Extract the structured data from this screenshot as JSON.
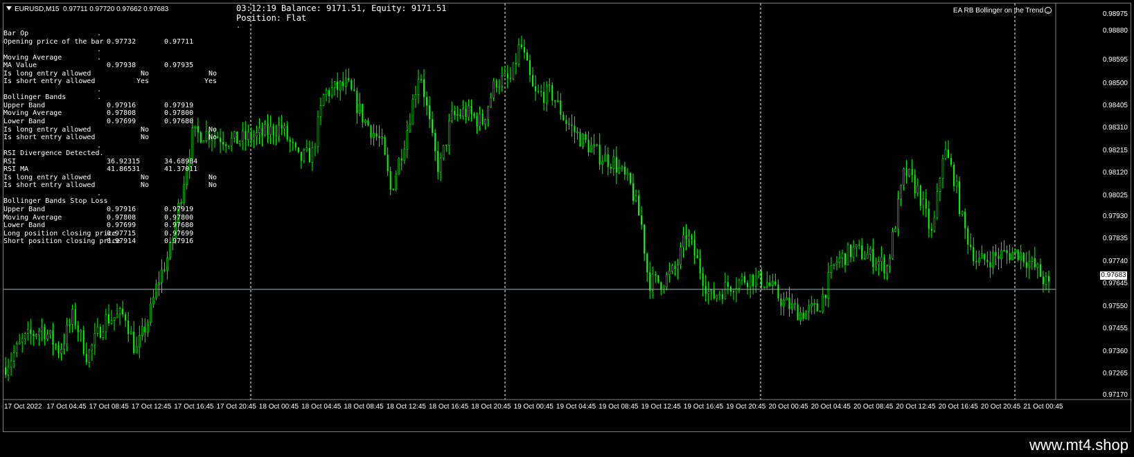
{
  "header": {
    "symbol": "EURUSD,M15",
    "ohlc": "0.97711 0.97720 0.97662 0.97683"
  },
  "status": {
    "line1": "03:12:19 Balance: 9171.51, Equity: 9171.51",
    "line2": "Position: Flat",
    "dot": "."
  },
  "ea_name": "EA RB Bollinger on the Trend",
  "info_panel": [
    {
      "label": "Bar Op",
      "v1": "",
      "v2": "",
      "v3": "",
      "dot": "."
    },
    {
      "label": "Opening price of the bar",
      "v1": "0.97732",
      "v2": "0.97711",
      "v3": ""
    },
    {
      "label": "",
      "v1": "",
      "v2": "",
      "v3": "",
      "dot": "."
    },
    {
      "label": "Moving Average",
      "v1": "",
      "v2": "",
      "v3": "",
      "dot": "."
    },
    {
      "label": "MA Value",
      "v1": "0.97938",
      "v2": "0.97935",
      "v3": ""
    },
    {
      "label": "Is long entry allowed",
      "v1": "No",
      "v2": "",
      "v3": "No"
    },
    {
      "label": "Is short entry allowed",
      "v1": "Yes",
      "v2": "",
      "v3": "Yes"
    },
    {
      "label": "",
      "v1": "",
      "v2": "",
      "v3": "",
      "dot": "."
    },
    {
      "label": "Bollinger Bands",
      "v1": "",
      "v2": "",
      "v3": "",
      "dot": "."
    },
    {
      "label": "Upper Band",
      "v1": "0.97916",
      "v2": "0.97919",
      "v3": ""
    },
    {
      "label": "Moving Average",
      "v1": "0.97808",
      "v2": "0.97800",
      "v3": ""
    },
    {
      "label": "Lower Band",
      "v1": "0.97699",
      "v2": "0.97680",
      "v3": ""
    },
    {
      "label": "Is long entry allowed",
      "v1": "No",
      "v2": "",
      "v3": "No"
    },
    {
      "label": "Is short entry allowed",
      "v1": "No",
      "v2": "",
      "v3": "No"
    },
    {
      "label": "",
      "v1": "",
      "v2": "",
      "v3": "",
      "dot": "."
    },
    {
      "label": "RSI Divergence Detected.",
      "v1": "",
      "v2": "",
      "v3": ""
    },
    {
      "label": "RSI",
      "v1": "36.92315",
      "v2": "34.68984",
      "v3": ""
    },
    {
      "label": "RSI MA",
      "v1": "41.86531",
      "v2": "41.37011",
      "v3": ""
    },
    {
      "label": "Is long entry allowed",
      "v1": "No",
      "v2": "",
      "v3": "No"
    },
    {
      "label": "Is short entry allowed",
      "v1": "No",
      "v2": "",
      "v3": "No"
    },
    {
      "label": "",
      "v1": "",
      "v2": "",
      "v3": "",
      "dot": "."
    },
    {
      "label": "Bollinger Bands Stop Loss",
      "v1": "",
      "v2": "",
      "v3": ""
    },
    {
      "label": "Upper Band",
      "v1": "0.97916",
      "v2": "0.97919",
      "v3": ""
    },
    {
      "label": "Moving Average",
      "v1": "0.97808",
      "v2": "0.97800",
      "v3": ""
    },
    {
      "label": "Lower Band",
      "v1": "0.97699",
      "v2": "0.97680",
      "v3": ""
    },
    {
      "label": "Long position closing price",
      "v1": "0.97715",
      "v2": "0.97699",
      "v3": ""
    },
    {
      "label": "Short position closing price",
      "v1": "0.97914",
      "v2": "0.97916",
      "v3": ""
    }
  ],
  "price_axis": {
    "labels": [
      "0.98975",
      "0.98880",
      "0.98595",
      "0.98500",
      "0.98405",
      "0.98310",
      "0.98215",
      "0.98120",
      "0.98025",
      "0.97930",
      "0.97835",
      "0.97740",
      "0.97645",
      "0.97550",
      "0.97455",
      "0.97360",
      "0.97265",
      "0.97170"
    ],
    "current_price": "0.97683"
  },
  "time_axis": {
    "labels": [
      "17 Oct 2022",
      "17 Oct 04:45",
      "17 Oct 08:45",
      "17 Oct 12:45",
      "17 Oct 16:45",
      "17 Oct 20:45",
      "18 Oct 00:45",
      "18 Oct 04:45",
      "18 Oct 08:45",
      "18 Oct 12:45",
      "18 Oct 16:45",
      "18 Oct 20:45",
      "19 Oct 00:45",
      "19 Oct 04:45",
      "19 Oct 08:45",
      "19 Oct 12:45",
      "19 Oct 16:45",
      "19 Oct 20:45",
      "20 Oct 00:45",
      "20 Oct 04:45",
      "20 Oct 08:45",
      "20 Oct 12:45",
      "20 Oct 16:45",
      "20 Oct 20:45",
      "21 Oct 00:45"
    ]
  },
  "chart_data": {
    "type": "candlestick",
    "symbol": "EURUSD",
    "timeframe": "M15",
    "ylim": [
      0.9717,
      0.99
    ],
    "current_price": 0.97683,
    "bar_count": 375,
    "day_separators": [
      "18 Oct",
      "19 Oct",
      "20 Oct",
      "21 Oct"
    ],
    "colors": {
      "candle": "#00ff00",
      "background": "#000000",
      "price_line": "#a0b4c8",
      "separator": "#ffffff"
    },
    "approx_closes": [
      {
        "x": 0,
        "y": 0.9731
      },
      {
        "x": 28,
        "y": 0.9744
      },
      {
        "x": 55,
        "y": 0.975
      },
      {
        "x": 80,
        "y": 0.9739
      },
      {
        "x": 100,
        "y": 0.9756
      },
      {
        "x": 120,
        "y": 0.9736
      },
      {
        "x": 145,
        "y": 0.9754
      },
      {
        "x": 175,
        "y": 0.9756
      },
      {
        "x": 190,
        "y": 0.9738
      },
      {
        "x": 210,
        "y": 0.9756
      },
      {
        "x": 222,
        "y": 0.9772
      },
      {
        "x": 240,
        "y": 0.9787
      },
      {
        "x": 262,
        "y": 0.9825
      },
      {
        "x": 272,
        "y": 0.9842
      },
      {
        "x": 295,
        "y": 0.9843
      },
      {
        "x": 330,
        "y": 0.9839
      },
      {
        "x": 370,
        "y": 0.9842
      },
      {
        "x": 400,
        "y": 0.9846
      },
      {
        "x": 425,
        "y": 0.983
      },
      {
        "x": 445,
        "y": 0.9833
      },
      {
        "x": 462,
        "y": 0.9862
      },
      {
        "x": 495,
        "y": 0.9866
      },
      {
        "x": 520,
        "y": 0.9849
      },
      {
        "x": 545,
        "y": 0.9838
      },
      {
        "x": 558,
        "y": 0.9815
      },
      {
        "x": 580,
        "y": 0.9842
      },
      {
        "x": 600,
        "y": 0.9874
      },
      {
        "x": 620,
        "y": 0.9835
      },
      {
        "x": 628,
        "y": 0.9825
      },
      {
        "x": 645,
        "y": 0.985
      },
      {
        "x": 665,
        "y": 0.9853
      },
      {
        "x": 690,
        "y": 0.9848
      },
      {
        "x": 710,
        "y": 0.9868
      },
      {
        "x": 732,
        "y": 0.9868
      },
      {
        "x": 745,
        "y": 0.9886
      },
      {
        "x": 765,
        "y": 0.9861
      },
      {
        "x": 790,
        "y": 0.9862
      },
      {
        "x": 810,
        "y": 0.9849
      },
      {
        "x": 830,
        "y": 0.9841
      },
      {
        "x": 860,
        "y": 0.9832
      },
      {
        "x": 880,
        "y": 0.9829
      },
      {
        "x": 905,
        "y": 0.9817
      },
      {
        "x": 920,
        "y": 0.9799
      },
      {
        "x": 930,
        "y": 0.9772
      },
      {
        "x": 950,
        "y": 0.9772
      },
      {
        "x": 970,
        "y": 0.9778
      },
      {
        "x": 985,
        "y": 0.9795
      },
      {
        "x": 1000,
        "y": 0.9782
      },
      {
        "x": 1020,
        "y": 0.9764
      },
      {
        "x": 1045,
        "y": 0.977
      },
      {
        "x": 1075,
        "y": 0.9774
      },
      {
        "x": 1100,
        "y": 0.9772
      },
      {
        "x": 1125,
        "y": 0.9762
      },
      {
        "x": 1150,
        "y": 0.9757
      },
      {
        "x": 1175,
        "y": 0.9759
      },
      {
        "x": 1200,
        "y": 0.9781
      },
      {
        "x": 1225,
        "y": 0.9787
      },
      {
        "x": 1250,
        "y": 0.9784
      },
      {
        "x": 1275,
        "y": 0.9779
      },
      {
        "x": 1300,
        "y": 0.9825
      },
      {
        "x": 1320,
        "y": 0.9815
      },
      {
        "x": 1340,
        "y": 0.9793
      },
      {
        "x": 1356,
        "y": 0.9836
      },
      {
        "x": 1372,
        "y": 0.9821
      },
      {
        "x": 1385,
        "y": 0.9798
      },
      {
        "x": 1405,
        "y": 0.9781
      },
      {
        "x": 1440,
        "y": 0.9785
      },
      {
        "x": 1465,
        "y": 0.9786
      },
      {
        "x": 1490,
        "y": 0.9778
      },
      {
        "x": 1510,
        "y": 0.97683
      }
    ]
  },
  "watermark": "www.mt4.shop"
}
